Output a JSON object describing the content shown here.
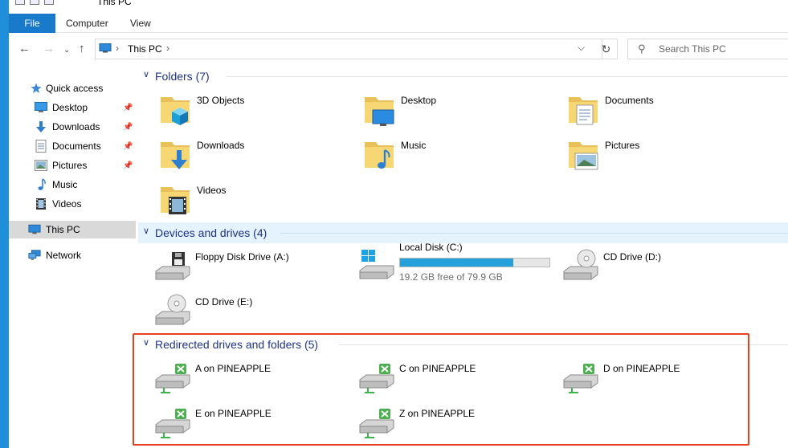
{
  "window": {
    "title": "This PC"
  },
  "ribbon": {
    "tabs": [
      "File",
      "Computer",
      "View"
    ]
  },
  "address": {
    "crumbs": [
      "This PC"
    ],
    "separator": "›"
  },
  "search": {
    "placeholder": "Search This PC"
  },
  "nav": {
    "quick_access": "Quick access",
    "items": [
      {
        "label": "Desktop",
        "icon": "desktop-icon",
        "pinned": true
      },
      {
        "label": "Downloads",
        "icon": "downloads-icon",
        "pinned": true
      },
      {
        "label": "Documents",
        "icon": "documents-icon",
        "pinned": true
      },
      {
        "label": "Pictures",
        "icon": "pictures-icon",
        "pinned": true
      },
      {
        "label": "Music",
        "icon": "music-icon",
        "pinned": false
      },
      {
        "label": "Videos",
        "icon": "videos-icon",
        "pinned": false
      }
    ],
    "this_pc": "This PC",
    "network": "Network"
  },
  "groups": {
    "folders": {
      "title": "Folders (7)",
      "items": [
        "3D Objects",
        "Desktop",
        "Documents",
        "Downloads",
        "Music",
        "Pictures",
        "Videos"
      ]
    },
    "devices": {
      "title": "Devices and drives (4)",
      "items": [
        {
          "name": "Floppy Disk Drive (A:)",
          "type": "floppy"
        },
        {
          "name": "Local Disk (C:)",
          "type": "disk",
          "free": "19.2 GB free of 79.9 GB",
          "used_fraction": 0.76
        },
        {
          "name": "CD Drive (D:)",
          "type": "cd"
        },
        {
          "name": "CD Drive (E:)",
          "type": "cd"
        }
      ]
    },
    "redirected": {
      "title": "Redirected drives and folders (5)",
      "items": [
        "A on PINEAPPLE",
        "C on PINEAPPLE",
        "D on PINEAPPLE",
        "E on PINEAPPLE",
        "Z on PINEAPPLE"
      ]
    }
  },
  "colors": {
    "accent": "#1979ca",
    "group_title": "#1e3287",
    "drive_fill": "#26a0da",
    "annotation": "#e8411d"
  }
}
